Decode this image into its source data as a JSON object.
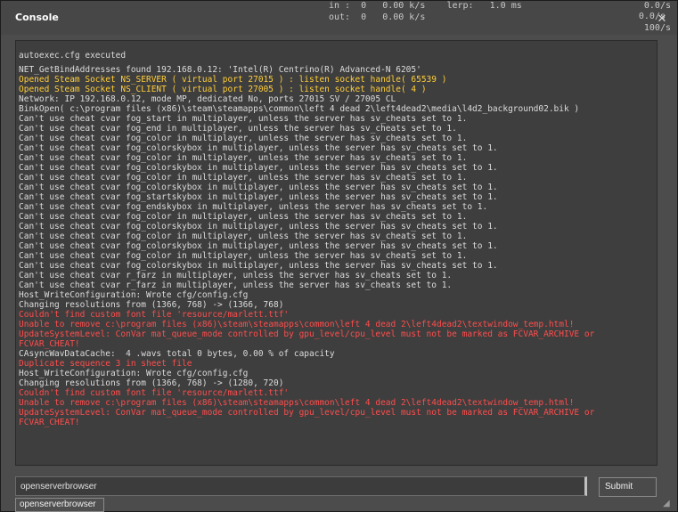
{
  "window": {
    "title": "Console"
  },
  "netgraph": {
    "in_line": "in :  0   0.00 k/s    lerp:   1.0 ms",
    "out_line": "out:  0   0.00 k/s",
    "right_1": "0.0/s",
    "right_2": "0.0/s",
    "right_3": "100/s"
  },
  "output": {
    "lines": [
      {
        "text": "",
        "style": "blank"
      },
      {
        "text": "autoexec.cfg executed",
        "style": "normal"
      },
      {
        "text": "",
        "style": "blank"
      },
      {
        "text": "NET_GetBindAddresses found 192.168.0.12: 'Intel(R) Centrino(R) Advanced-N 6205'",
        "style": "normal"
      },
      {
        "text": "Opened Steam Socket NS_SERVER ( virtual port 27015 ) : listen socket handle( 65539 )",
        "style": "yellow"
      },
      {
        "text": "Opened Steam Socket NS_CLIENT ( virtual port 27005 ) : listen socket handle( 4 )",
        "style": "yellow"
      },
      {
        "text": "Network: IP 192.168.0.12, mode MP, dedicated No, ports 27015 SV / 27005 CL",
        "style": "normal"
      },
      {
        "text": "BinkOpen( c:\\program files (x86)\\steam\\steamapps\\common\\left 4 dead 2\\left4dead2\\media\\l4d2_background02.bik )",
        "style": "normal"
      },
      {
        "text": "Can't use cheat cvar fog_start in multiplayer, unless the server has sv_cheats set to 1.",
        "style": "normal"
      },
      {
        "text": "Can't use cheat cvar fog_end in multiplayer, unless the server has sv_cheats set to 1.",
        "style": "normal"
      },
      {
        "text": "Can't use cheat cvar fog_color in multiplayer, unless the server has sv_cheats set to 1.",
        "style": "normal"
      },
      {
        "text": "Can't use cheat cvar fog_colorskybox in multiplayer, unless the server has sv_cheats set to 1.",
        "style": "normal"
      },
      {
        "text": "Can't use cheat cvar fog_color in multiplayer, unless the server has sv_cheats set to 1.",
        "style": "normal"
      },
      {
        "text": "Can't use cheat cvar fog_colorskybox in multiplayer, unless the server has sv_cheats set to 1.",
        "style": "normal"
      },
      {
        "text": "Can't use cheat cvar fog_color in multiplayer, unless the server has sv_cheats set to 1.",
        "style": "normal"
      },
      {
        "text": "Can't use cheat cvar fog_colorskybox in multiplayer, unless the server has sv_cheats set to 1.",
        "style": "normal"
      },
      {
        "text": "Can't use cheat cvar fog_startskybox in multiplayer, unless the server has sv_cheats set to 1.",
        "style": "normal"
      },
      {
        "text": "Can't use cheat cvar fog_endskybox in multiplayer, unless the server has sv_cheats set to 1.",
        "style": "normal"
      },
      {
        "text": "Can't use cheat cvar fog_color in multiplayer, unless the server has sv_cheats set to 1.",
        "style": "normal"
      },
      {
        "text": "Can't use cheat cvar fog_colorskybox in multiplayer, unless the server has sv_cheats set to 1.",
        "style": "normal"
      },
      {
        "text": "Can't use cheat cvar fog_color in multiplayer, unless the server has sv_cheats set to 1.",
        "style": "normal"
      },
      {
        "text": "Can't use cheat cvar fog_colorskybox in multiplayer, unless the server has sv_cheats set to 1.",
        "style": "normal"
      },
      {
        "text": "Can't use cheat cvar fog_color in multiplayer, unless the server has sv_cheats set to 1.",
        "style": "normal"
      },
      {
        "text": "Can't use cheat cvar fog_colorskybox in multiplayer, unless the server has sv_cheats set to 1.",
        "style": "normal"
      },
      {
        "text": "Can't use cheat cvar r_farz in multiplayer, unless the server has sv_cheats set to 1.",
        "style": "normal"
      },
      {
        "text": "Can't use cheat cvar r_farz in multiplayer, unless the server has sv_cheats set to 1.",
        "style": "normal"
      },
      {
        "text": "Host_WriteConfiguration: Wrote cfg/config.cfg",
        "style": "normal"
      },
      {
        "text": "Changing resolutions from (1366, 768) -> (1366, 768)",
        "style": "normal"
      },
      {
        "text": "Couldn't find custom font file 'resource/marlett.ttf'",
        "style": "red"
      },
      {
        "text": "Unable to remove c:\\program files (x86)\\steam\\steamapps\\common\\left 4 dead 2\\left4dead2\\textwindow_temp.html!",
        "style": "red"
      },
      {
        "text": "UpdateSystemLevel: ConVar mat_queue_mode controlled by gpu_level/cpu_level must not be marked as FCVAR_ARCHIVE or",
        "style": "red"
      },
      {
        "text": "FCVAR_CHEAT!",
        "style": "red"
      },
      {
        "text": "CAsyncWavDataCache:  4 .wavs total 0 bytes, 0.00 % of capacity",
        "style": "normal"
      },
      {
        "text": "Duplicate sequence 3 in sheet file",
        "style": "red"
      },
      {
        "text": "Host_WriteConfiguration: Wrote cfg/config.cfg",
        "style": "normal"
      },
      {
        "text": "Changing resolutions from (1366, 768) -> (1280, 720)",
        "style": "normal"
      },
      {
        "text": "Couldn't find custom font file 'resource/marlett.ttf'",
        "style": "red"
      },
      {
        "text": "Unable to remove c:\\program files (x86)\\steam\\steamapps\\common\\left 4 dead 2\\left4dead2\\textwindow_temp.html!",
        "style": "red"
      },
      {
        "text": "UpdateSystemLevel: ConVar mat_queue_mode controlled by gpu_level/cpu_level must not be marked as FCVAR_ARCHIVE or",
        "style": "red"
      },
      {
        "text": "FCVAR_CHEAT!",
        "style": "red"
      }
    ]
  },
  "input": {
    "value": "openserverbrowser"
  },
  "submit": {
    "label": "Submit"
  },
  "autocomplete": {
    "item": "openserverbrowser"
  },
  "colors": {
    "normal": "#dcdcdc",
    "yellow": "#ffce3a",
    "red": "#ff4d4d",
    "background": "#4c4c4c"
  }
}
